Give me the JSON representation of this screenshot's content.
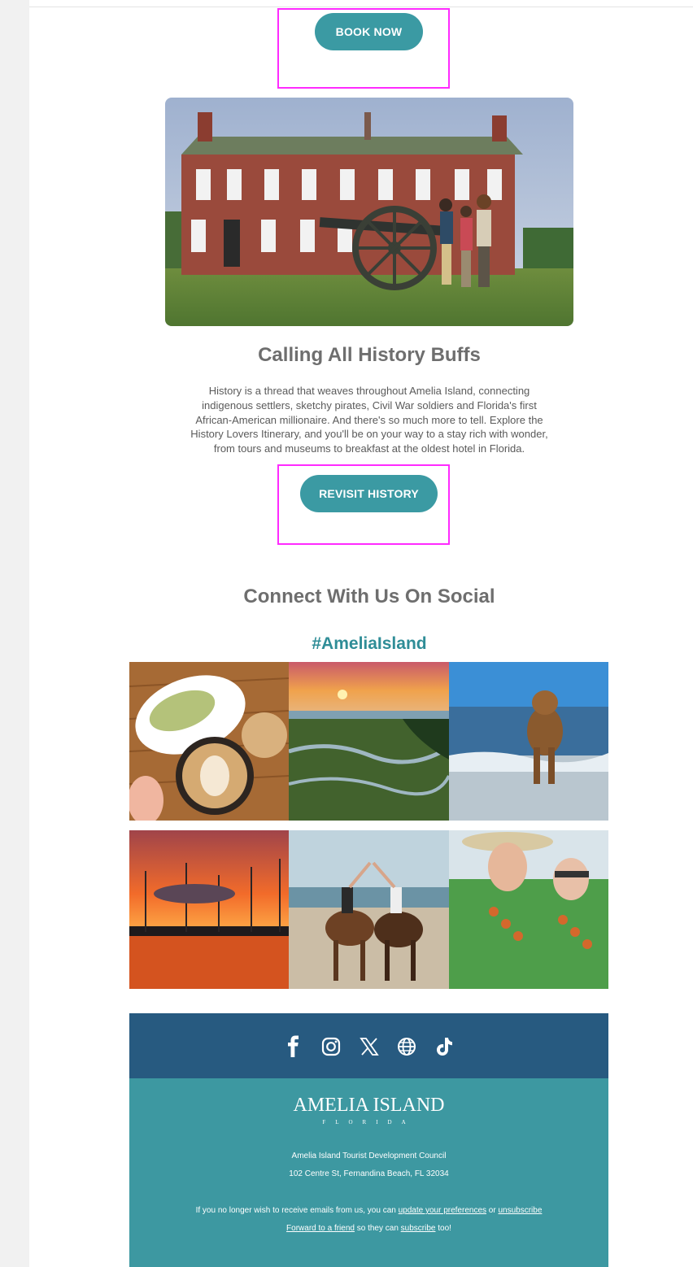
{
  "top_button": {
    "label": "BOOK NOW"
  },
  "hero_image": {
    "icon": "fort-clinch-cannon-photo"
  },
  "history_section": {
    "title": "Calling All History Buffs",
    "lines": [
      "History is a thread that weaves throughout Amelia Island, connecting",
      "indigenous settlers, sketchy pirates, Civil War soldiers and Florida's first",
      "African-American millionaire. And there's so much more to tell. Explore the",
      "History Lovers Itinerary, and you'll be on your way to a stay rich with wonder,",
      "from tours and museums to breakfast at the oldest hotel in Florida."
    ],
    "button_label": "REVISIT HISTORY"
  },
  "social_section": {
    "title": "Connect With Us On Social",
    "hashtag": "#AmeliaIsland"
  },
  "footer": {
    "social_icons": [
      "facebook-icon",
      "instagram-icon",
      "x-icon",
      "globe-icon",
      "tiktok-icon"
    ],
    "logo": "AMELIA ISLAND",
    "logo_sub": "FLORIDA",
    "org_name": "Amelia Island Tourist Development Council",
    "address": "102 Centre St, Fernandina Beach, FL 32034",
    "unsub_prefix": "If you no longer wish to receive emails from us, you can ",
    "update_link": "update your preferences",
    "unsub_or": " or ",
    "unsubscribe_link": "unsubscribe",
    "forward_link": "Forward to a friend",
    "forward_middle": " so they can ",
    "subscribe_link": "subscribe",
    "forward_suffix": " too!"
  },
  "colors": {
    "accent_teal": "#3b9aa3",
    "footer_blue": "#275a80",
    "footer_teal": "#3d98a1",
    "highlight": "#ff2bff"
  }
}
